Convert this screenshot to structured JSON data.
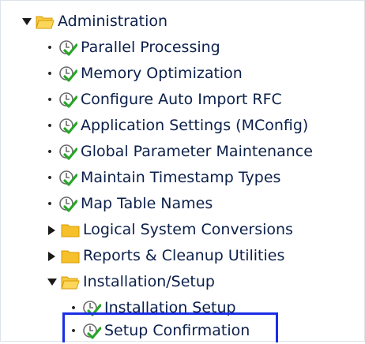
{
  "tree": {
    "root": {
      "label": "Administration",
      "icon": "folder-open-icon",
      "state": "expanded"
    },
    "items": [
      {
        "label": "Parallel Processing",
        "icon": "clock-check-icon"
      },
      {
        "label": "Memory Optimization",
        "icon": "clock-check-icon"
      },
      {
        "label": "Configure Auto Import RFC",
        "icon": "clock-check-icon"
      },
      {
        "label": "Application Settings (MConfig)",
        "icon": "clock-check-icon"
      },
      {
        "label": "Global Parameter Maintenance",
        "icon": "clock-check-icon"
      },
      {
        "label": "Maintain Timestamp Types",
        "icon": "clock-check-icon"
      },
      {
        "label": "Map Table Names",
        "icon": "clock-check-icon"
      }
    ],
    "folders": [
      {
        "label": "Logical System Conversions",
        "icon": "folder-closed-icon",
        "state": "collapsed"
      },
      {
        "label": "Reports & Cleanup Utilities",
        "icon": "folder-closed-icon",
        "state": "collapsed"
      },
      {
        "label": "Installation/Setup",
        "icon": "folder-open-icon",
        "state": "expanded"
      }
    ],
    "subitems": [
      {
        "label": "Installation Setup",
        "icon": "clock-check-icon"
      },
      {
        "label": "Setup Confirmation",
        "icon": "clock-check-icon",
        "highlighted": true
      }
    ]
  },
  "colors": {
    "text": "#0b1f4a",
    "folder": "#f5c02a",
    "folder_outline": "#d89b00",
    "check": "#2aa52a",
    "clock": "#6b6b6b",
    "highlight_border": "#1a2ee6"
  }
}
